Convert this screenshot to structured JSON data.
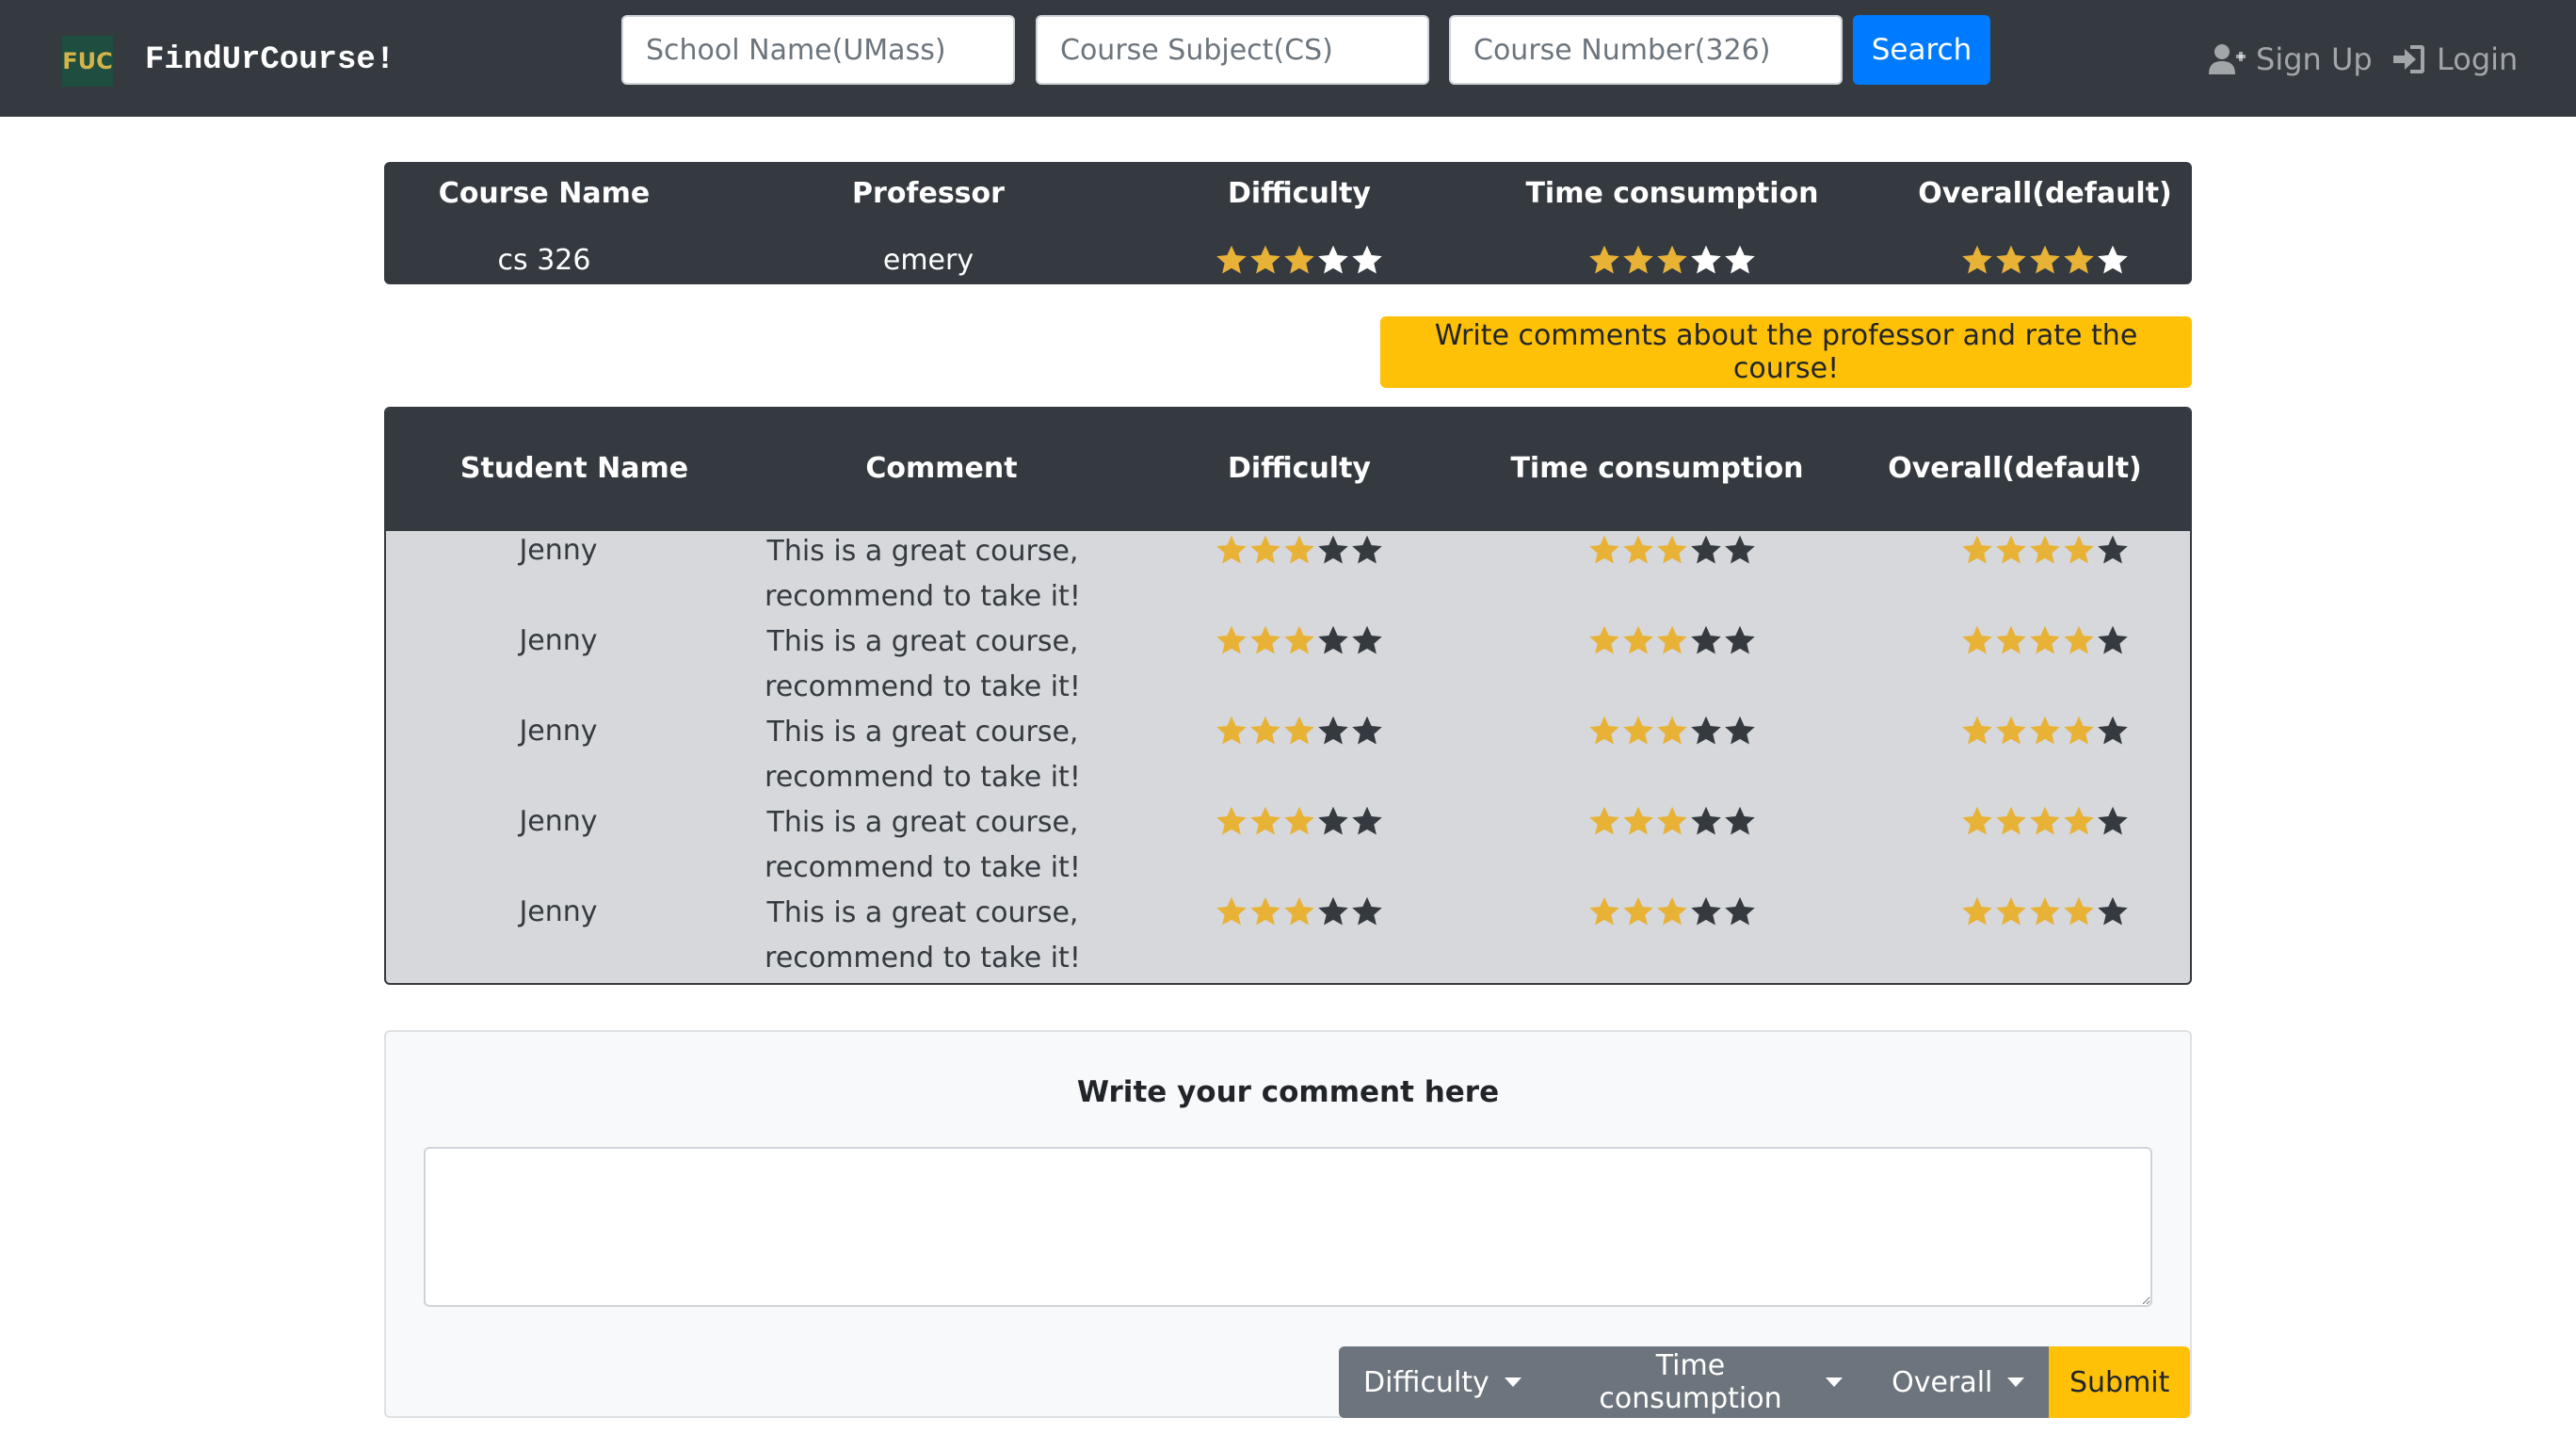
{
  "navbar": {
    "logo_text": "FUC",
    "brand": "FindUrCourse!",
    "school_placeholder": "School Name(UMass)",
    "subject_placeholder": "Course Subject(CS)",
    "number_placeholder": "Course Number(326)",
    "search_label": "Search",
    "signup_label": "Sign Up",
    "login_label": "Login"
  },
  "summary": {
    "headers": [
      "Course Name",
      "Professor",
      "Difficulty",
      "Time consumption",
      "Overall(default)"
    ],
    "course_name": "cs 326",
    "professor": "emery",
    "difficulty": 3,
    "time_consumption": 3,
    "overall": 4,
    "max_stars": 5
  },
  "cta_label": "Write comments about the professor and rate the course!",
  "comments": {
    "headers": [
      "Student Name",
      "Comment",
      "Difficulty",
      "Time consumption",
      "Overall(default)"
    ],
    "rows": [
      {
        "student": "Jenny",
        "line1": "This is a great course,",
        "line2": "recommend to take it!",
        "difficulty": 3,
        "time": 3,
        "overall": 4
      },
      {
        "student": "Jenny",
        "line1": "This is a great course,",
        "line2": "recommend to take it!",
        "difficulty": 3,
        "time": 3,
        "overall": 4
      },
      {
        "student": "Jenny",
        "line1": "This is a great course,",
        "line2": "recommend to take it!",
        "difficulty": 3,
        "time": 3,
        "overall": 4
      },
      {
        "student": "Jenny",
        "line1": "This is a great course,",
        "line2": "recommend to take it!",
        "difficulty": 3,
        "time": 3,
        "overall": 4
      },
      {
        "student": "Jenny",
        "line1": "This is a great course,",
        "line2": "recommend to take it!",
        "difficulty": 3,
        "time": 3,
        "overall": 4
      }
    ]
  },
  "write_panel": {
    "title": "Write your comment here",
    "difficulty_label": "Difficulty",
    "time_label": "Time consumption",
    "overall_label": "Overall",
    "submit_label": "Submit"
  },
  "colors": {
    "navbar": "#343a40",
    "primary": "#007bff",
    "warning": "#ffc107",
    "secondary": "#6c757d",
    "star_filled": "#e8b237",
    "star_empty_dark": "#343a40",
    "star_empty_light": "#ffffff",
    "row_background": "#d6d8db"
  }
}
